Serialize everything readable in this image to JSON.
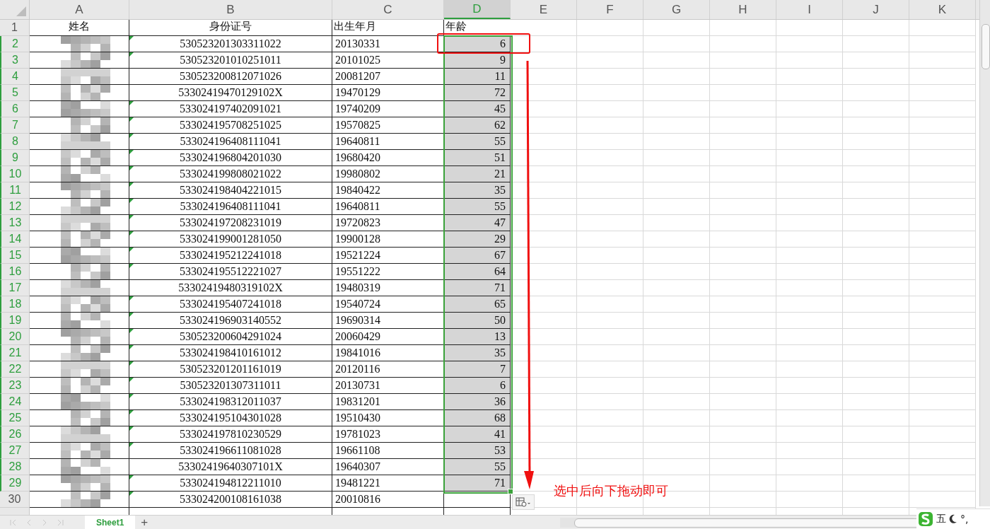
{
  "columns": [
    {
      "label": "A",
      "selected": false
    },
    {
      "label": "B",
      "selected": false
    },
    {
      "label": "C",
      "selected": false
    },
    {
      "label": "D",
      "selected": true
    },
    {
      "label": "E",
      "selected": false
    },
    {
      "label": "F",
      "selected": false
    },
    {
      "label": "G",
      "selected": false
    },
    {
      "label": "H",
      "selected": false
    },
    {
      "label": "I",
      "selected": false
    },
    {
      "label": "J",
      "selected": false
    },
    {
      "label": "K",
      "selected": false
    }
  ],
  "header_row": {
    "row_number": "1",
    "cells": [
      "姓名",
      "身份证号",
      "出生年月",
      "年龄"
    ]
  },
  "rows": [
    {
      "row_number": "2",
      "id": "530523201303311022",
      "birth": "20130331",
      "age": "6",
      "selected": true,
      "flag": true
    },
    {
      "row_number": "3",
      "id": "530523201010251011",
      "birth": "20101025",
      "age": "9",
      "selected": true,
      "flag": true
    },
    {
      "row_number": "4",
      "id": "530523200812071026",
      "birth": "20081207",
      "age": "11",
      "selected": true,
      "flag": false
    },
    {
      "row_number": "5",
      "id": "53302419470129102X",
      "birth": "19470129",
      "age": "72",
      "selected": true,
      "flag": false
    },
    {
      "row_number": "6",
      "id": "533024197402091021",
      "birth": "19740209",
      "age": "45",
      "selected": true,
      "flag": true
    },
    {
      "row_number": "7",
      "id": "533024195708251025",
      "birth": "19570825",
      "age": "62",
      "selected": true,
      "flag": true
    },
    {
      "row_number": "8",
      "id": "533024196408111041",
      "birth": "19640811",
      "age": "55",
      "selected": true,
      "flag": true
    },
    {
      "row_number": "9",
      "id": "533024196804201030",
      "birth": "19680420",
      "age": "51",
      "selected": true,
      "flag": true
    },
    {
      "row_number": "10",
      "id": "533024199808021022",
      "birth": "19980802",
      "age": "21",
      "selected": true,
      "flag": true
    },
    {
      "row_number": "11",
      "id": "533024198404221015",
      "birth": "19840422",
      "age": "35",
      "selected": true,
      "flag": true
    },
    {
      "row_number": "12",
      "id": "533024196408111041",
      "birth": "19640811",
      "age": "55",
      "selected": true,
      "flag": true
    },
    {
      "row_number": "13",
      "id": "533024197208231019",
      "birth": "19720823",
      "age": "47",
      "selected": true,
      "flag": true
    },
    {
      "row_number": "14",
      "id": "533024199001281050",
      "birth": "19900128",
      "age": "29",
      "selected": true,
      "flag": true
    },
    {
      "row_number": "15",
      "id": "533024195212241018",
      "birth": "19521224",
      "age": "67",
      "selected": true,
      "flag": true
    },
    {
      "row_number": "16",
      "id": "533024195512221027",
      "birth": "19551222",
      "age": "64",
      "selected": true,
      "flag": true
    },
    {
      "row_number": "17",
      "id": "53302419480319102X",
      "birth": "19480319",
      "age": "71",
      "selected": true,
      "flag": false
    },
    {
      "row_number": "18",
      "id": "533024195407241018",
      "birth": "19540724",
      "age": "65",
      "selected": true,
      "flag": true
    },
    {
      "row_number": "19",
      "id": "533024196903140552",
      "birth": "19690314",
      "age": "50",
      "selected": true,
      "flag": true
    },
    {
      "row_number": "20",
      "id": "530523200604291024",
      "birth": "20060429",
      "age": "13",
      "selected": true,
      "flag": true
    },
    {
      "row_number": "21",
      "id": "533024198410161012",
      "birth": "19841016",
      "age": "35",
      "selected": true,
      "flag": true
    },
    {
      "row_number": "22",
      "id": "530523201201161019",
      "birth": "20120116",
      "age": "7",
      "selected": true,
      "flag": true
    },
    {
      "row_number": "23",
      "id": "530523201307311011",
      "birth": "20130731",
      "age": "6",
      "selected": true,
      "flag": true
    },
    {
      "row_number": "24",
      "id": "533024198312011037",
      "birth": "19831201",
      "age": "36",
      "selected": true,
      "flag": true
    },
    {
      "row_number": "25",
      "id": "533024195104301028",
      "birth": "19510430",
      "age": "68",
      "selected": true,
      "flag": true
    },
    {
      "row_number": "26",
      "id": "533024197810230529",
      "birth": "19781023",
      "age": "41",
      "selected": true,
      "flag": true
    },
    {
      "row_number": "27",
      "id": "533024196611081028",
      "birth": "19661108",
      "age": "53",
      "selected": true,
      "flag": true
    },
    {
      "row_number": "28",
      "id": "53302419640307101X",
      "birth": "19640307",
      "age": "55",
      "selected": true,
      "flag": false
    },
    {
      "row_number": "29",
      "id": "533024194812211010",
      "birth": "19481221",
      "age": "71",
      "selected": true,
      "flag": true
    },
    {
      "row_number": "30",
      "id": "533024200108161038",
      "birth": "20010816",
      "selected": false,
      "flag": true
    }
  ],
  "annotation": {
    "text": "选中后向下拖动即可"
  },
  "sheet_tabs": [
    {
      "label": "Sheet1",
      "selected": true
    }
  ],
  "add_sheet": "+",
  "ime": {
    "mode": "五",
    "punct": "°,"
  }
}
